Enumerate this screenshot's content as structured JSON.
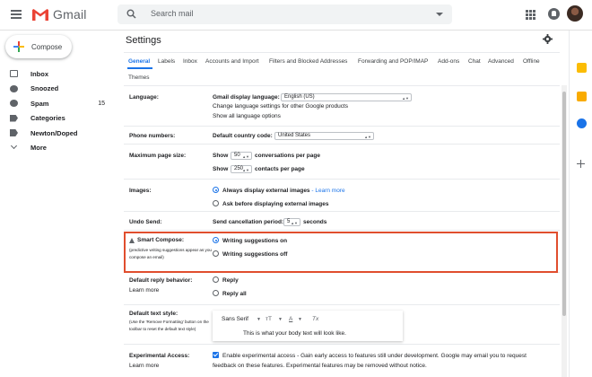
{
  "header": {
    "app_name": "Gmail",
    "search_placeholder": "Search mail"
  },
  "sidebar": {
    "compose_label": "Compose",
    "items": [
      {
        "label": "Inbox",
        "icon": "inbox-icon",
        "count": "",
        "bold": true
      },
      {
        "label": "Snoozed",
        "icon": "clock-icon",
        "count": "",
        "bold": true
      },
      {
        "label": "Spam",
        "icon": "alert-icon",
        "count": "15",
        "bold": true
      },
      {
        "label": "Categories",
        "icon": "label-icon",
        "count": "",
        "bold": true
      },
      {
        "label": "Newton/Doped",
        "icon": "label-icon",
        "count": "",
        "bold": true
      },
      {
        "label": "More",
        "icon": "chevron-down-icon",
        "count": "",
        "bold": true
      }
    ]
  },
  "main": {
    "title": "Settings",
    "tabs": [
      "General",
      "Labels",
      "Inbox",
      "Accounts and Import",
      "Filters and Blocked Addresses",
      "Forwarding and POP/IMAP",
      "Add-ons",
      "Chat",
      "Advanced",
      "Offline",
      "Themes"
    ],
    "active_tab": "General"
  },
  "settings": {
    "language": {
      "label": "Language:",
      "display_label": "Gmail display language:",
      "selected": "English (US)",
      "change_link": "Change language settings for other Google products",
      "show_all_link": "Show all language options"
    },
    "phone": {
      "label": "Phone numbers:",
      "country_label": "Default country code:",
      "selected": "United States"
    },
    "page_size": {
      "label": "Maximum page size:",
      "show1": "Show",
      "conv_value": "50",
      "conv_suffix": "conversations per page",
      "show2": "Show",
      "contacts_value": "250",
      "contacts_suffix": "contacts per page"
    },
    "images": {
      "label": "Images:",
      "option1": "Always display external images",
      "option1_link": "- Learn more",
      "option2": "Ask before displaying external images"
    },
    "undo": {
      "label": "Undo Send:",
      "period_label": "Send cancellation period:",
      "value": "5",
      "suffix": "seconds"
    },
    "smart_compose": {
      "label": "Smart Compose:",
      "note": "(predictive writing suggestions appear as you compose an email)",
      "option1": "Writing suggestions on",
      "option2": "Writing suggestions off"
    },
    "reply": {
      "label": "Default reply behavior:",
      "learn_more": "Learn more",
      "option1": "Reply",
      "option2": "Reply all"
    },
    "text_style": {
      "label": "Default text style:",
      "note": "(Use the 'Remove Formatting' button on the toolbar to reset the default text style)",
      "font": "Sans Serif",
      "size_glyph": "тT",
      "color_glyph": "A",
      "clear_glyph": "Tx",
      "preview": "This is what your body text will look like."
    },
    "experimental": {
      "label": "Experimental Access:",
      "learn_more": "Learn more",
      "line1": "Enable experimental access - Gain early access to features still under development. Google may email you to request",
      "line2": "feedback on these features. Experimental features may be removed without notice."
    }
  },
  "colors": {
    "accent": "#1a73e8",
    "highlight": "#e04e2e"
  }
}
